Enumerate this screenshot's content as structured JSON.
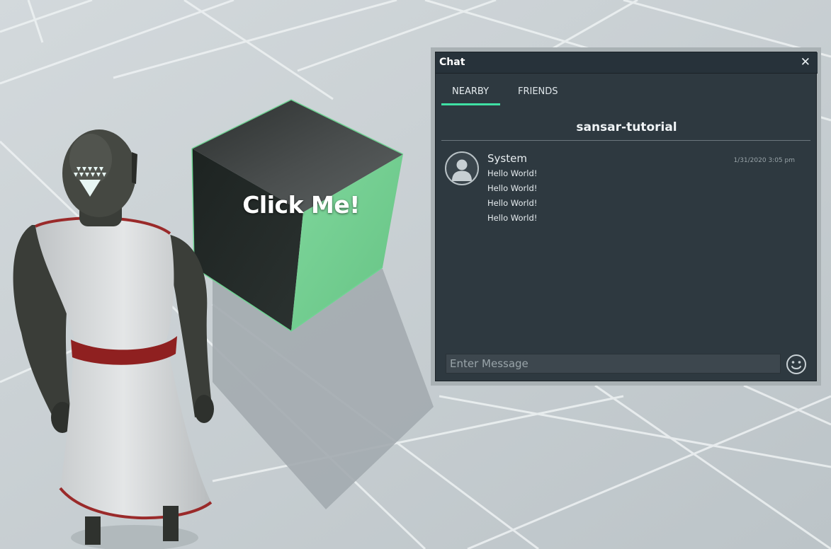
{
  "scene": {
    "cube_label": "Click Me!",
    "cube_accent_color": "#7ed49a",
    "floor_color": "#c9d0d4"
  },
  "chat": {
    "title": "Chat",
    "close_icon": "close-icon",
    "tabs": [
      {
        "label": "NEARBY",
        "active": true
      },
      {
        "label": "FRIENDS",
        "active": false
      }
    ],
    "accent_color": "#3fe0a4",
    "room_name": "sansar-tutorial",
    "message_group": {
      "avatar_icon": "user-avatar-icon",
      "sender": "System",
      "timestamp": "1/31/2020  3:05 pm",
      "messages": [
        "Hello World!",
        "Hello World!",
        "Hello World!",
        "Hello World!"
      ]
    },
    "input": {
      "placeholder": "Enter Message",
      "value": ""
    },
    "emoji_icon": "smiley-icon"
  }
}
